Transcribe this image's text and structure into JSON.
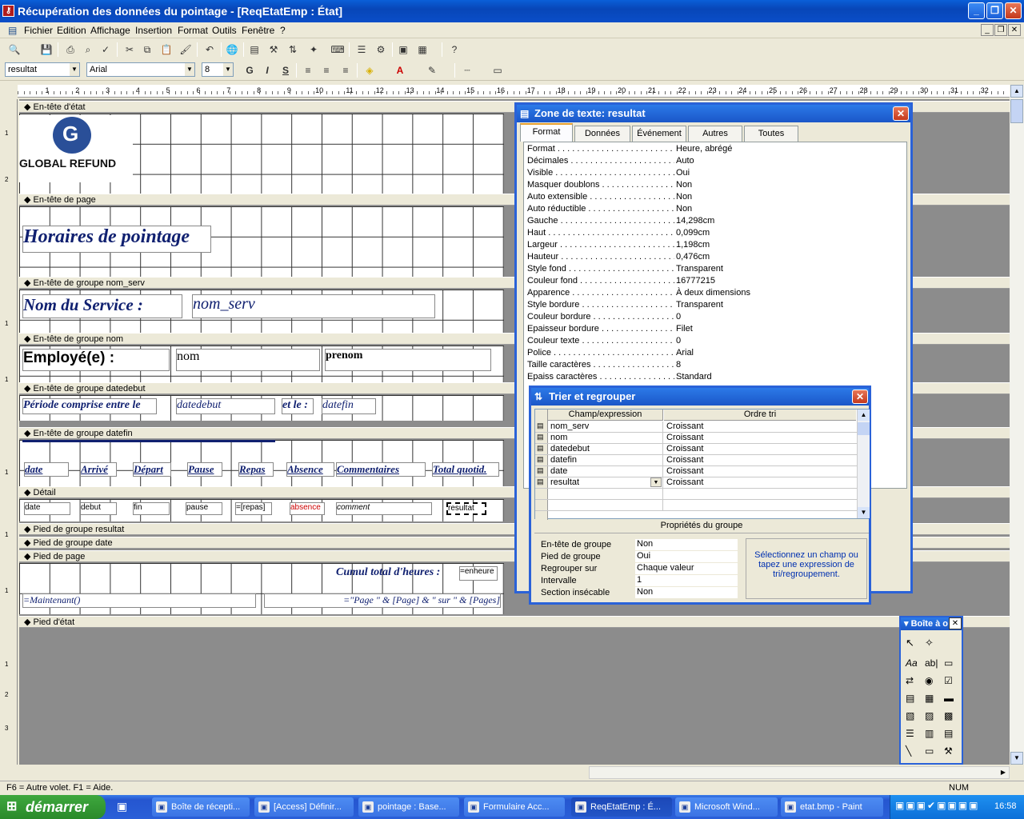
{
  "window": {
    "title": "Récupération des données du pointage - [ReqEtatEmp : État]",
    "min": "_",
    "restore": "❐",
    "close": "✕"
  },
  "menu": [
    "Fichier",
    "Edition",
    "Affichage",
    "Insertion",
    "Format",
    "Outils",
    "Fenêtre",
    "?"
  ],
  "toolbar2": {
    "object_combo": "resultat",
    "font_combo": "Arial",
    "size_combo": "8",
    "bold": "G",
    "italic": "I",
    "underline": "S"
  },
  "ruler": [
    "1",
    "2",
    "3",
    "4",
    "5",
    "6",
    "7",
    "8",
    "9",
    "10",
    "11",
    "12",
    "13",
    "14",
    "15",
    "16",
    "17",
    "18",
    "19",
    "20",
    "21",
    "22",
    "23",
    "24",
    "25",
    "26",
    "27",
    "28",
    "29",
    "30",
    "31",
    "32"
  ],
  "sections": {
    "etat_header": "En-tête d'état",
    "page_header": "En-tête de page",
    "grp_nom_serv": "En-tête de groupe nom_serv",
    "grp_nom": "En-tête de groupe nom",
    "grp_datedebut": "En-tête de groupe datedebut",
    "grp_datefin": "En-tête de groupe datefin",
    "detail": "Détail",
    "foot_resultat": "Pied de groupe resultat",
    "foot_date": "Pied de groupe date",
    "page_footer": "Pied de page",
    "etat_footer": "Pied d'état"
  },
  "report": {
    "logo_text": "GLOBAL REFUND",
    "title": "Horaires de pointage",
    "service_label": "Nom du Service :",
    "service_field": "nom_serv",
    "employe_label": "Employé(e) :",
    "nom_field": "nom",
    "prenom_field": "prenom",
    "periode_label": "Période comprise entre le",
    "datedebut_field": "datedebut",
    "et_le_label": "et le :",
    "datefin_field": "datefin",
    "col_headers": [
      "date",
      "Arrivé",
      "Départ",
      "Pause",
      "Repas",
      "Absence",
      "Commentaires",
      "Total quotid."
    ],
    "detail_fields": [
      "date",
      "debut",
      "fin",
      "pause",
      "=[repas]",
      "absence",
      "comment",
      "resultat"
    ],
    "cumul_label": "Cumul total d'heures :",
    "cumul_field": "=enheure",
    "now_field": "=Maintenant()",
    "page_field": "=\"Page \" & [Page] & \" sur \" & [Pages]"
  },
  "props": {
    "title": "Zone de texte: resultat",
    "tabs": [
      "Format",
      "Données",
      "Événement",
      "Autres",
      "Toutes"
    ],
    "rows": [
      [
        "Format",
        "Heure, abrégé"
      ],
      [
        "Décimales",
        "Auto"
      ],
      [
        "Visible",
        "Oui"
      ],
      [
        "Masquer doublons",
        "Non"
      ],
      [
        "Auto extensible",
        "Non"
      ],
      [
        "Auto réductible",
        "Non"
      ],
      [
        "Gauche",
        "14,298cm"
      ],
      [
        "Haut",
        "0,099cm"
      ],
      [
        "Largeur",
        "1,198cm"
      ],
      [
        "Hauteur",
        "0,476cm"
      ],
      [
        "Style fond",
        "Transparent"
      ],
      [
        "Couleur fond",
        "16777215"
      ],
      [
        "Apparence",
        "À deux dimensions"
      ],
      [
        "Style bordure",
        "Transparent"
      ],
      [
        "Couleur bordure",
        "0"
      ],
      [
        "Epaisseur bordure",
        "Filet"
      ],
      [
        "Couleur texte",
        "0"
      ],
      [
        "Police",
        "Arial"
      ],
      [
        "Taille caractères",
        "8"
      ],
      [
        "Epaiss caractères",
        "Standard"
      ]
    ]
  },
  "sort": {
    "title": "Trier et regrouper",
    "col1": "Champ/expression",
    "col2": "Ordre tri",
    "rows": [
      [
        "nom_serv",
        "Croissant"
      ],
      [
        "nom",
        "Croissant"
      ],
      [
        "datedebut",
        "Croissant"
      ],
      [
        "datefin",
        "Croissant"
      ],
      [
        "date",
        "Croissant"
      ],
      [
        "resultat",
        "Croissant"
      ]
    ],
    "group_props_title": "Propriétés du groupe",
    "group_props": [
      [
        "En-tête de groupe",
        "Non"
      ],
      [
        "Pied de groupe",
        "Oui"
      ],
      [
        "Regrouper sur",
        "Chaque valeur"
      ],
      [
        "Intervalle",
        "1"
      ],
      [
        "Section insécable",
        "Non"
      ]
    ],
    "hint": "Sélectionnez un champ ou tapez une expression de tri/regroupement."
  },
  "toolbox": {
    "title": "Boîte à o"
  },
  "status": {
    "text": "F6 = Autre volet.  F1 = Aide.",
    "num": "NUM"
  },
  "taskbar": {
    "start": "démarrer",
    "tasks": [
      "Boîte de récepti...",
      "[Access] Définir...",
      "pointage : Base...",
      "Formulaire Acc...",
      "ReqEtatEmp : É...",
      "Microsoft Wind...",
      "etat.bmp - Paint"
    ],
    "clock": "16:58"
  }
}
